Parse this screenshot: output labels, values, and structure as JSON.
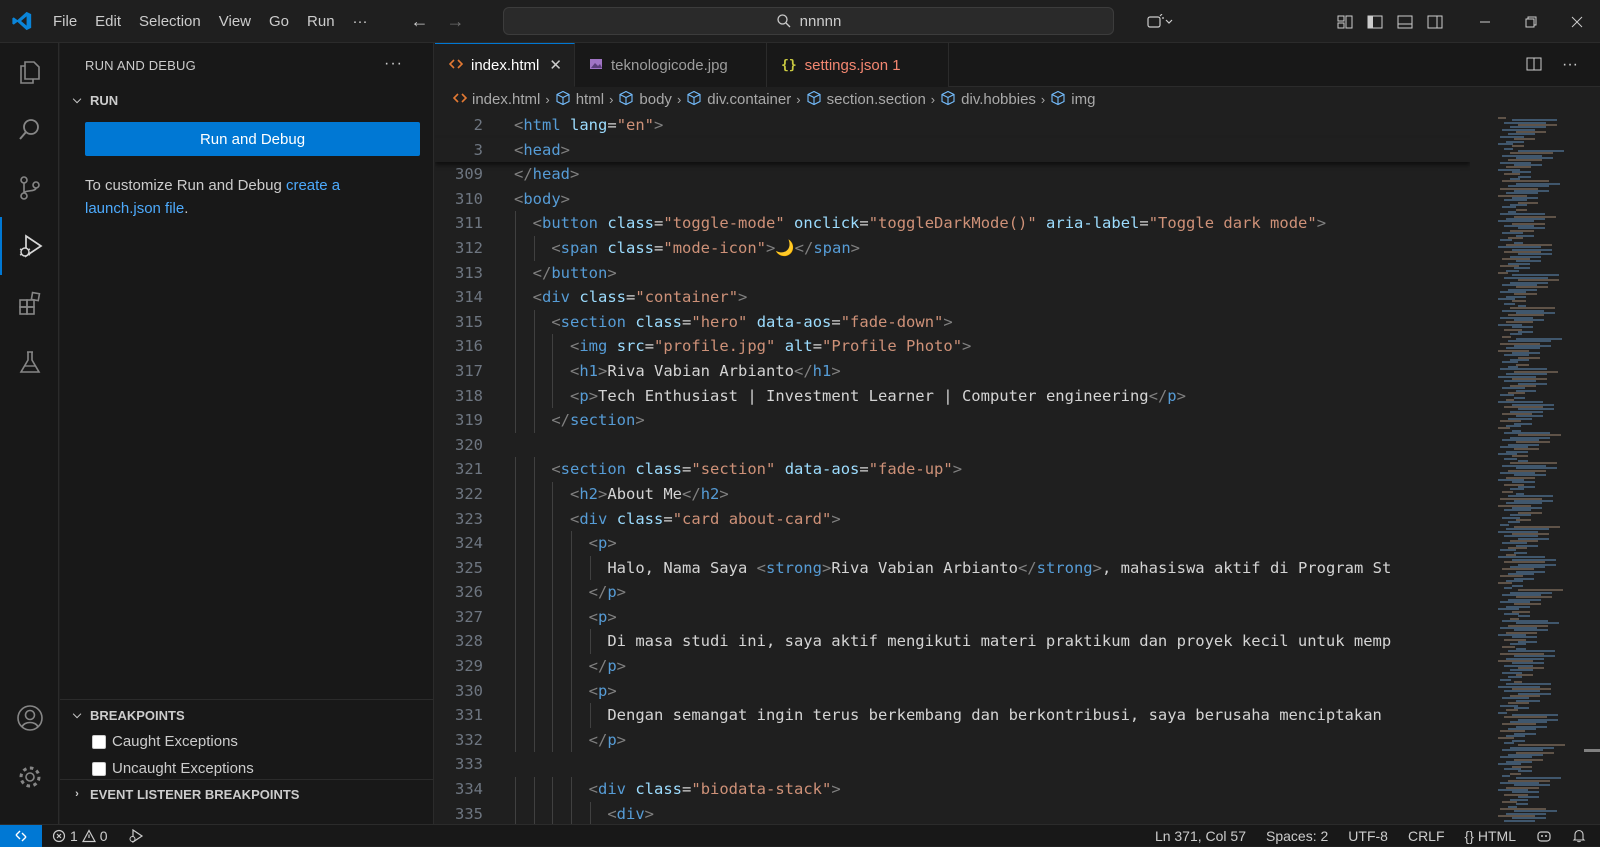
{
  "titlebar": {
    "menu": [
      "File",
      "Edit",
      "Selection",
      "View",
      "Go",
      "Run",
      "···"
    ],
    "search_text": "nnnnn"
  },
  "sidebar": {
    "title": "RUN AND DEBUG",
    "run_section": "RUN",
    "run_button": "Run and Debug",
    "customize_prefix": "To customize Run and Debug ",
    "customize_link": "create a launch.json file",
    "customize_suffix": ".",
    "breakpoints_section": "BREAKPOINTS",
    "breakpoints": [
      "Caught Exceptions",
      "Uncaught Exceptions"
    ],
    "event_listener_section": "EVENT LISTENER BREAKPOINTS"
  },
  "tabs": [
    {
      "label": "index.html",
      "icon": "html-file-icon",
      "active": true,
      "color": "#ffffff"
    },
    {
      "label": "teknologicode.jpg",
      "icon": "image-file-icon",
      "active": false,
      "color": "#9d9d9d"
    },
    {
      "label": "settings.json 1",
      "icon": "json-file-icon",
      "active": false,
      "color": "#f48771"
    }
  ],
  "breadcrumb": [
    "index.html",
    "html",
    "body",
    "div.container",
    "section.section",
    "div.hobbies",
    "img"
  ],
  "code": {
    "sticky_lines": [
      {
        "num": "2",
        "indent": 0,
        "tokens": [
          [
            "br",
            "<"
          ],
          [
            "tag",
            "html"
          ],
          [
            "txt",
            " "
          ],
          [
            "attr",
            "lang"
          ],
          [
            "txt",
            "="
          ],
          [
            "str",
            "\"en\""
          ],
          [
            "br",
            ">"
          ]
        ]
      },
      {
        "num": "3",
        "indent": 0,
        "tokens": [
          [
            "br",
            "<"
          ],
          [
            "tag",
            "head"
          ],
          [
            "br",
            ">"
          ]
        ]
      }
    ],
    "lines": [
      {
        "num": "309",
        "indent": 0,
        "tokens": [
          [
            "br",
            "</"
          ],
          [
            "tag",
            "head"
          ],
          [
            "br",
            ">"
          ]
        ]
      },
      {
        "num": "310",
        "indent": 0,
        "tokens": [
          [
            "br",
            "<"
          ],
          [
            "tag",
            "body"
          ],
          [
            "br",
            ">"
          ]
        ]
      },
      {
        "num": "311",
        "indent": 1,
        "tokens": [
          [
            "br",
            "<"
          ],
          [
            "tag",
            "button"
          ],
          [
            "txt",
            " "
          ],
          [
            "attr",
            "class"
          ],
          [
            "txt",
            "="
          ],
          [
            "str",
            "\"toggle-mode\""
          ],
          [
            "txt",
            " "
          ],
          [
            "attr",
            "onclick"
          ],
          [
            "txt",
            "="
          ],
          [
            "str",
            "\"toggleDarkMode()\""
          ],
          [
            "txt",
            " "
          ],
          [
            "attr",
            "aria-label"
          ],
          [
            "txt",
            "="
          ],
          [
            "str",
            "\"Toggle dark mode\""
          ],
          [
            "br",
            ">"
          ]
        ]
      },
      {
        "num": "312",
        "indent": 2,
        "tokens": [
          [
            "br",
            "<"
          ],
          [
            "tag",
            "span"
          ],
          [
            "txt",
            " "
          ],
          [
            "attr",
            "class"
          ],
          [
            "txt",
            "="
          ],
          [
            "str",
            "\"mode-icon\""
          ],
          [
            "br",
            ">"
          ],
          [
            "txt",
            "🌙"
          ],
          [
            "br",
            "</"
          ],
          [
            "tag",
            "span"
          ],
          [
            "br",
            ">"
          ]
        ]
      },
      {
        "num": "313",
        "indent": 1,
        "tokens": [
          [
            "br",
            "</"
          ],
          [
            "tag",
            "button"
          ],
          [
            "br",
            ">"
          ]
        ]
      },
      {
        "num": "314",
        "indent": 1,
        "tokens": [
          [
            "br",
            "<"
          ],
          [
            "tag",
            "div"
          ],
          [
            "txt",
            " "
          ],
          [
            "attr",
            "class"
          ],
          [
            "txt",
            "="
          ],
          [
            "str",
            "\"container\""
          ],
          [
            "br",
            ">"
          ]
        ]
      },
      {
        "num": "315",
        "indent": 2,
        "tokens": [
          [
            "br",
            "<"
          ],
          [
            "tag",
            "section"
          ],
          [
            "txt",
            " "
          ],
          [
            "attr",
            "class"
          ],
          [
            "txt",
            "="
          ],
          [
            "str",
            "\"hero\""
          ],
          [
            "txt",
            " "
          ],
          [
            "attr",
            "data-aos"
          ],
          [
            "txt",
            "="
          ],
          [
            "str",
            "\"fade-down\""
          ],
          [
            "br",
            ">"
          ]
        ]
      },
      {
        "num": "316",
        "indent": 3,
        "tokens": [
          [
            "br",
            "<"
          ],
          [
            "tag",
            "img"
          ],
          [
            "txt",
            " "
          ],
          [
            "attr",
            "src"
          ],
          [
            "txt",
            "="
          ],
          [
            "str",
            "\"profile.jpg\""
          ],
          [
            "txt",
            " "
          ],
          [
            "attr",
            "alt"
          ],
          [
            "txt",
            "="
          ],
          [
            "str",
            "\"Profile Photo\""
          ],
          [
            "br",
            ">"
          ]
        ]
      },
      {
        "num": "317",
        "indent": 3,
        "tokens": [
          [
            "br",
            "<"
          ],
          [
            "tag",
            "h1"
          ],
          [
            "br",
            ">"
          ],
          [
            "txt",
            "Riva Vabian Arbianto"
          ],
          [
            "br",
            "</"
          ],
          [
            "tag",
            "h1"
          ],
          [
            "br",
            ">"
          ]
        ]
      },
      {
        "num": "318",
        "indent": 3,
        "tokens": [
          [
            "br",
            "<"
          ],
          [
            "tag",
            "p"
          ],
          [
            "br",
            ">"
          ],
          [
            "txt",
            "Tech Enthusiast | Investment Learner | Computer engineering"
          ],
          [
            "br",
            "</"
          ],
          [
            "tag",
            "p"
          ],
          [
            "br",
            ">"
          ]
        ]
      },
      {
        "num": "319",
        "indent": 2,
        "tokens": [
          [
            "br",
            "</"
          ],
          [
            "tag",
            "section"
          ],
          [
            "br",
            ">"
          ]
        ]
      },
      {
        "num": "320",
        "indent": 0,
        "tokens": []
      },
      {
        "num": "321",
        "indent": 2,
        "tokens": [
          [
            "br",
            "<"
          ],
          [
            "tag",
            "section"
          ],
          [
            "txt",
            " "
          ],
          [
            "attr",
            "class"
          ],
          [
            "txt",
            "="
          ],
          [
            "str",
            "\"section\""
          ],
          [
            "txt",
            " "
          ],
          [
            "attr",
            "data-aos"
          ],
          [
            "txt",
            "="
          ],
          [
            "str",
            "\"fade-up\""
          ],
          [
            "br",
            ">"
          ]
        ]
      },
      {
        "num": "322",
        "indent": 3,
        "tokens": [
          [
            "br",
            "<"
          ],
          [
            "tag",
            "h2"
          ],
          [
            "br",
            ">"
          ],
          [
            "txt",
            "About Me"
          ],
          [
            "br",
            "</"
          ],
          [
            "tag",
            "h2"
          ],
          [
            "br",
            ">"
          ]
        ]
      },
      {
        "num": "323",
        "indent": 3,
        "tokens": [
          [
            "br",
            "<"
          ],
          [
            "tag",
            "div"
          ],
          [
            "txt",
            " "
          ],
          [
            "attr",
            "class"
          ],
          [
            "txt",
            "="
          ],
          [
            "str",
            "\"card about-card\""
          ],
          [
            "br",
            ">"
          ]
        ]
      },
      {
        "num": "324",
        "indent": 4,
        "tokens": [
          [
            "br",
            "<"
          ],
          [
            "tag",
            "p"
          ],
          [
            "br",
            ">"
          ]
        ]
      },
      {
        "num": "325",
        "indent": 5,
        "tokens": [
          [
            "txt",
            "Halo, Nama Saya "
          ],
          [
            "br",
            "<"
          ],
          [
            "tag",
            "strong"
          ],
          [
            "br",
            ">"
          ],
          [
            "txt",
            "Riva Vabian Arbianto"
          ],
          [
            "br",
            "</"
          ],
          [
            "tag",
            "strong"
          ],
          [
            "br",
            ">"
          ],
          [
            "txt",
            ", mahasiswa aktif di Program St"
          ]
        ]
      },
      {
        "num": "326",
        "indent": 4,
        "tokens": [
          [
            "br",
            "</"
          ],
          [
            "tag",
            "p"
          ],
          [
            "br",
            ">"
          ]
        ]
      },
      {
        "num": "327",
        "indent": 4,
        "tokens": [
          [
            "br",
            "<"
          ],
          [
            "tag",
            "p"
          ],
          [
            "br",
            ">"
          ]
        ]
      },
      {
        "num": "328",
        "indent": 5,
        "tokens": [
          [
            "txt",
            "Di masa studi ini, saya aktif mengikuti materi praktikum dan proyek kecil untuk memp"
          ]
        ]
      },
      {
        "num": "329",
        "indent": 4,
        "tokens": [
          [
            "br",
            "</"
          ],
          [
            "tag",
            "p"
          ],
          [
            "br",
            ">"
          ]
        ]
      },
      {
        "num": "330",
        "indent": 4,
        "tokens": [
          [
            "br",
            "<"
          ],
          [
            "tag",
            "p"
          ],
          [
            "br",
            ">"
          ]
        ]
      },
      {
        "num": "331",
        "indent": 5,
        "tokens": [
          [
            "txt",
            "Dengan semangat ingin terus berkembang dan berkontribusi, saya berusaha menciptakan "
          ]
        ]
      },
      {
        "num": "332",
        "indent": 4,
        "tokens": [
          [
            "br",
            "</"
          ],
          [
            "tag",
            "p"
          ],
          [
            "br",
            ">"
          ]
        ]
      },
      {
        "num": "333",
        "indent": 0,
        "tokens": []
      },
      {
        "num": "334",
        "indent": 4,
        "tokens": [
          [
            "br",
            "<"
          ],
          [
            "tag",
            "div"
          ],
          [
            "txt",
            " "
          ],
          [
            "attr",
            "class"
          ],
          [
            "txt",
            "="
          ],
          [
            "str",
            "\"biodata-stack\""
          ],
          [
            "br",
            ">"
          ]
        ]
      },
      {
        "num": "335",
        "indent": 5,
        "tokens": [
          [
            "br",
            "<"
          ],
          [
            "tag",
            "div"
          ],
          [
            "br",
            ">"
          ]
        ]
      }
    ]
  },
  "statusbar": {
    "errors": "1",
    "warnings": "0",
    "position": "Ln 371, Col 57",
    "spaces": "Spaces: 2",
    "encoding": "UTF-8",
    "eol": "CRLF",
    "language": "HTML"
  },
  "colors": {
    "accent": "#0078d4",
    "link": "#4daafc",
    "tag": "#569cd6",
    "attr": "#9cdcfe",
    "string": "#ce9178"
  }
}
